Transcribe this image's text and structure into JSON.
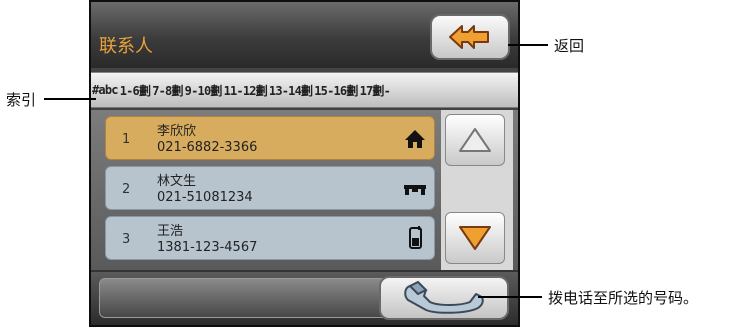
{
  "header": {
    "title": "联系人"
  },
  "index_bar": {
    "items": [
      "#abc",
      "1-6劃",
      "7-8劃",
      "9-10劃",
      "11-12劃",
      "13-14劃",
      "15-16劃",
      "17劃-"
    ]
  },
  "contacts": [
    {
      "index": "1",
      "name": "李欣欣",
      "phone": "021-6882-3366",
      "type_icon": "home-icon",
      "selected": true
    },
    {
      "index": "2",
      "name": "林文生",
      "phone": "021-51081234",
      "type_icon": "office-icon",
      "selected": false
    },
    {
      "index": "3",
      "name": "王浩",
      "phone": "1381-123-4567",
      "type_icon": "mobile-phone-icon",
      "selected": false
    }
  ],
  "annotations": {
    "back": "返回",
    "index": "索引",
    "dial": "拨电话至所选的号码。"
  },
  "colors": {
    "title": "#e8a23a",
    "selected_row": "#d8ac5e",
    "row": "#b7c4ce",
    "back_arrow": "#f0a030",
    "down_arrow": "#f0a030"
  }
}
